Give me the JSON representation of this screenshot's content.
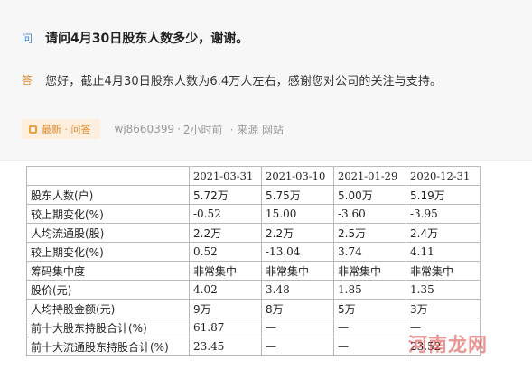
{
  "question": {
    "tag": "问",
    "text": "请问4月30日股东人数多少，谢谢。"
  },
  "answer": {
    "tag": "答",
    "text": "您好，截止4月30日股东人数为6.4万人左右，感谢您对公司的关注与支持。"
  },
  "meta": {
    "badge": "最新 · 问答",
    "user": "wj8660399",
    "separator": "·",
    "time": "2小时前",
    "source": "· 来源 网站"
  },
  "table": {
    "headers": [
      "",
      "2021-03-31",
      "2021-03-10",
      "2021-01-29",
      "2020-12-31"
    ],
    "rows": [
      [
        "股东人数(户)",
        "5.72万",
        "5.75万",
        "5.00万",
        "5.19万"
      ],
      [
        "较上期变化(%)",
        "-0.52",
        "15.00",
        "-3.60",
        "-3.95"
      ],
      [
        "人均流通股(股)",
        "2.2万",
        "2.2万",
        "2.5万",
        "2.4万"
      ],
      [
        "较上期变化(%)",
        "0.52",
        "-13.04",
        "3.74",
        "4.11"
      ],
      [
        "筹码集中度",
        "非常集中",
        "非常集中",
        "非常集中",
        "非常集中"
      ],
      [
        "股价(元)",
        "4.02",
        "3.48",
        "1.85",
        "1.35"
      ],
      [
        "人均持股金额(元)",
        "9万",
        "8万",
        "5万",
        "3万"
      ],
      [
        "前十大股东持股合计(%)",
        "61.87",
        "—",
        "—",
        "—"
      ],
      [
        "前十大流通股东持股合计(%)",
        "23.45",
        "—",
        "—",
        "23.52"
      ]
    ]
  },
  "watermark": "河南龙网",
  "colors": {
    "question_tag": "#4a8bd6",
    "answer_tag": "#e08a2c",
    "badge_bg": "#fdeedd",
    "card_bg": "#f7f7f8",
    "watermark": "#dc3c3c"
  }
}
